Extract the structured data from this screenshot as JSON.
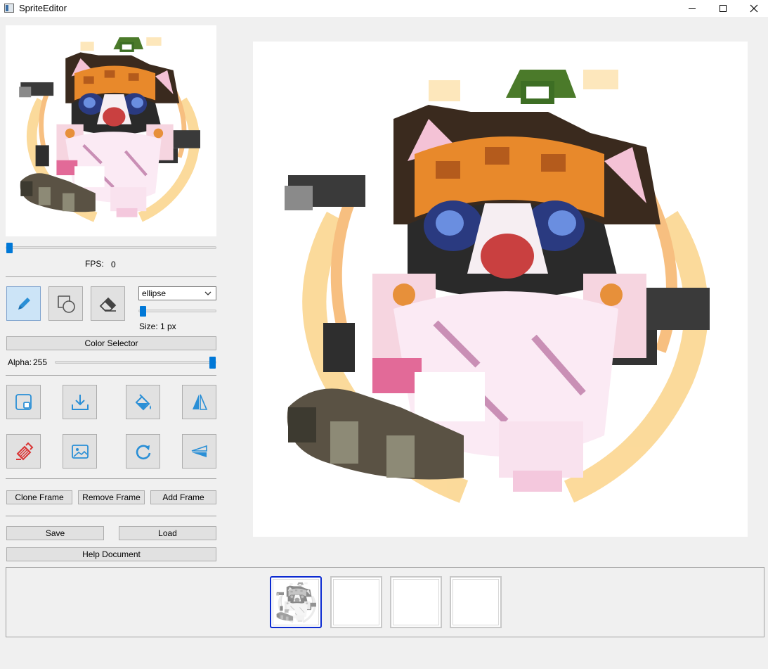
{
  "window": {
    "title": "SpriteEditor"
  },
  "preview": {
    "fps_label": "FPS:",
    "fps_value": "0",
    "fps_slider_value": 0
  },
  "tools": {
    "shape_select": {
      "value": "ellipse"
    },
    "size_label": "Size:",
    "size_value": "1 px",
    "size_slider_value": 1,
    "color_selector_label": "Color Selector",
    "alpha_label": "Alpha:",
    "alpha_value": "255",
    "alpha_slider_value": 255,
    "alpha_slider_max": 255
  },
  "actions": {
    "clone_frame": "Clone Frame",
    "remove_frame": "Remove Frame",
    "add_frame": "Add Frame",
    "save": "Save",
    "load": "Load",
    "help": "Help Document"
  },
  "icons": [
    "pencil-icon",
    "shape-icon",
    "eraser-icon",
    "new-canvas-icon",
    "download-icon",
    "paint-bucket-icon",
    "flip-horizontal-icon",
    "clear-icon",
    "image-import-icon",
    "rotate-icon",
    "flip-vertical-icon"
  ],
  "colors": {
    "accent": "#0078d7",
    "selected_frame_border": "#0c2bd1",
    "icon_blue": "#2a8fd6",
    "icon_red": "#d93535"
  },
  "frames": {
    "count": 4,
    "selected_index": 0
  }
}
